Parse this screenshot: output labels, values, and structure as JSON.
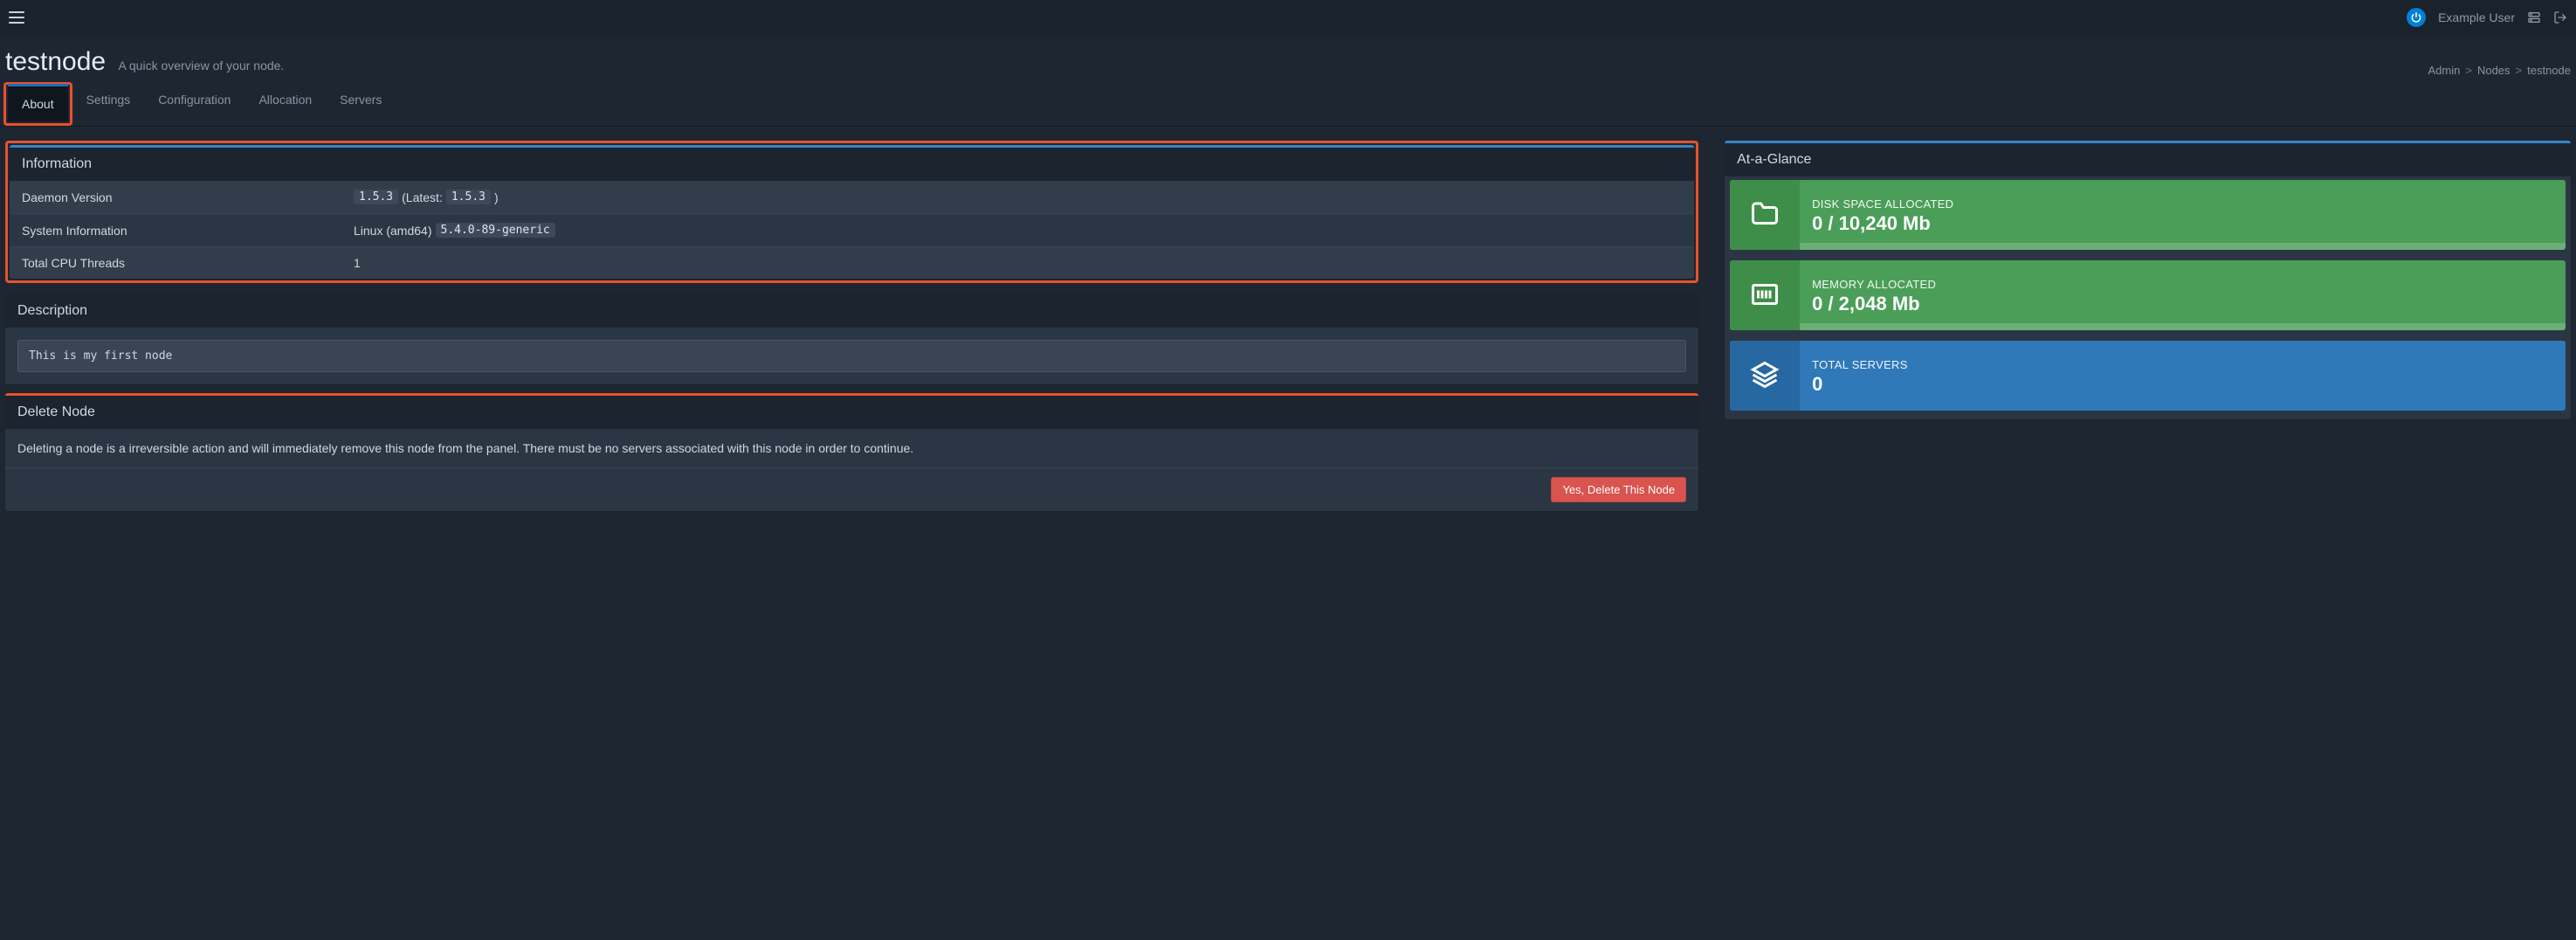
{
  "header": {
    "user_name": "Example User"
  },
  "page": {
    "title": "testnode",
    "subtitle": "A quick overview of your node.",
    "breadcrumb": {
      "admin": "Admin",
      "nodes": "Nodes",
      "current": "testnode"
    }
  },
  "tabs": {
    "about": "About",
    "settings": "Settings",
    "configuration": "Configuration",
    "allocation": "Allocation",
    "servers": "Servers"
  },
  "info": {
    "panel_title": "Information",
    "rows": {
      "daemon_version": {
        "label": "Daemon Version",
        "value": "1.5.3",
        "latest_label": "(Latest:",
        "latest_value": "1.5.3",
        "latest_close": ")"
      },
      "system_info": {
        "label": "System Information",
        "os": "Linux (amd64)",
        "kernel": "5.4.0-89-generic"
      },
      "cpu_threads": {
        "label": "Total CPU Threads",
        "value": "1"
      }
    }
  },
  "description": {
    "panel_title": "Description",
    "text": "This is my first node"
  },
  "delete": {
    "panel_title": "Delete Node",
    "warning": "Deleting a node is a irreversible action and will immediately remove this node from the panel. There must be no servers associated with this node in order to continue.",
    "button": "Yes, Delete This Node"
  },
  "glance": {
    "panel_title": "At-a-Glance",
    "disk": {
      "title": "DISK SPACE ALLOCATED",
      "value": "0 / 10,240 Mb"
    },
    "memory": {
      "title": "MEMORY ALLOCATED",
      "value": "0 / 2,048 Mb"
    },
    "servers": {
      "title": "TOTAL SERVERS",
      "value": "0"
    }
  },
  "colors": {
    "accent": "#3a84c5",
    "danger": "#e8522d",
    "stat_green": "#4b9e58",
    "stat_blue": "#2f79b9"
  }
}
